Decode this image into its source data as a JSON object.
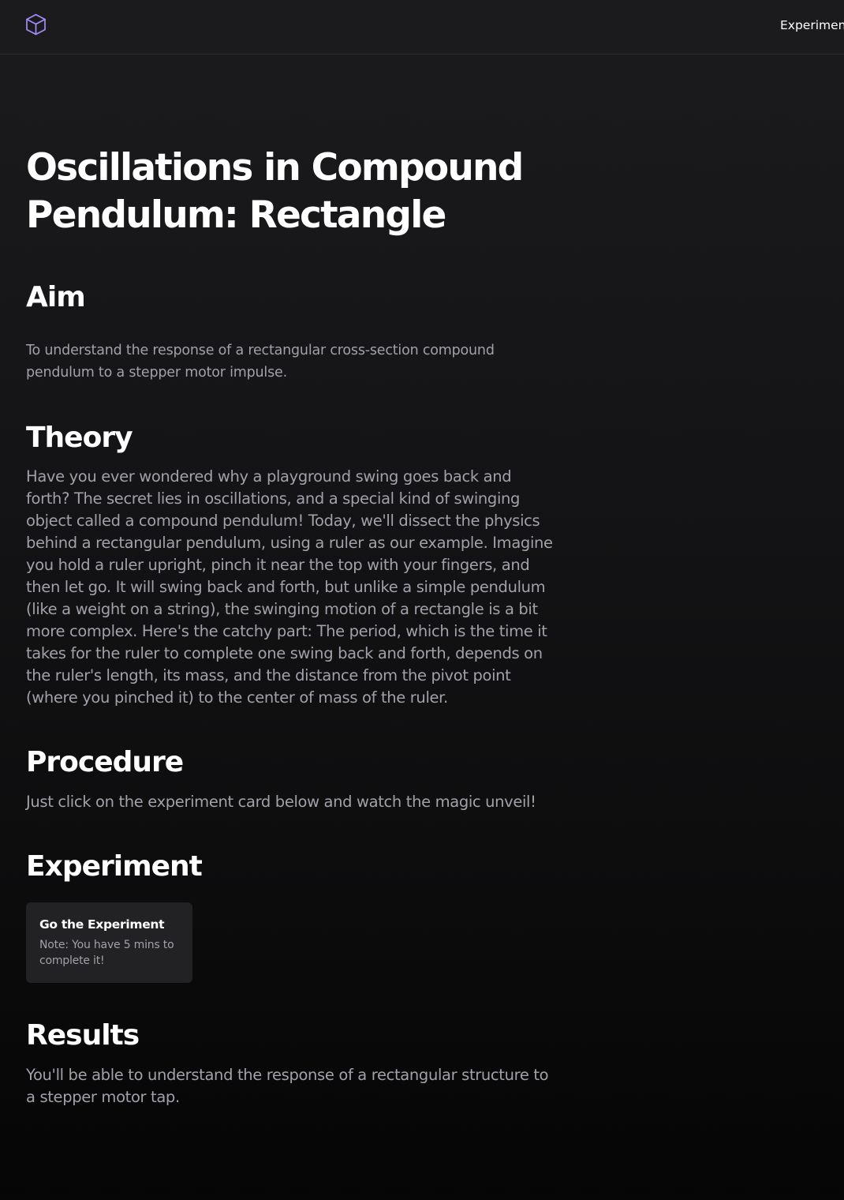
{
  "header": {
    "logo_icon": "cube-icon",
    "logo_color": "#a78bfa",
    "nav_label": "Experiment"
  },
  "page": {
    "title": "Oscillations in Compound Pendulum: Rectangle"
  },
  "sections": {
    "aim": {
      "heading": "Aim",
      "text": "To understand the response of a rectangular cross-section compound pendulum to a stepper motor impulse."
    },
    "theory": {
      "heading": "Theory",
      "text": "Have you ever wondered why a playground swing goes back and forth? The secret lies in oscillations, and a special kind of swinging object called a compound pendulum! Today, we'll dissect the physics behind a rectangular pendulum, using a ruler as our example. Imagine you hold a ruler upright, pinch it near the top with your fingers, and then let go. It will swing back and forth, but unlike a simple pendulum (like a weight on a string), the swinging motion of a rectangle is a bit more complex. Here's the catchy part: The period, which is the time it takes for the ruler to complete one swing back and forth, depends on the ruler's length, its mass, and the distance from the pivot point (where you pinched it) to the center of mass of the ruler."
    },
    "procedure": {
      "heading": "Procedure",
      "text": "Just click on the experiment card below and watch the magic unveil!"
    },
    "experiment": {
      "heading": "Experiment",
      "card_title": "Go the Experiment",
      "card_note": "Note: You have 5 mins to complete it!"
    },
    "results": {
      "heading": "Results",
      "text": "You'll be able to understand the response of a rectangular structure to a stepper motor tap."
    }
  },
  "colors": {
    "background_top": "#1b1b1e",
    "background_bottom": "#050505",
    "heading_text": "#ffffff",
    "body_text": "#a1a1aa",
    "card_background": "#222225"
  }
}
